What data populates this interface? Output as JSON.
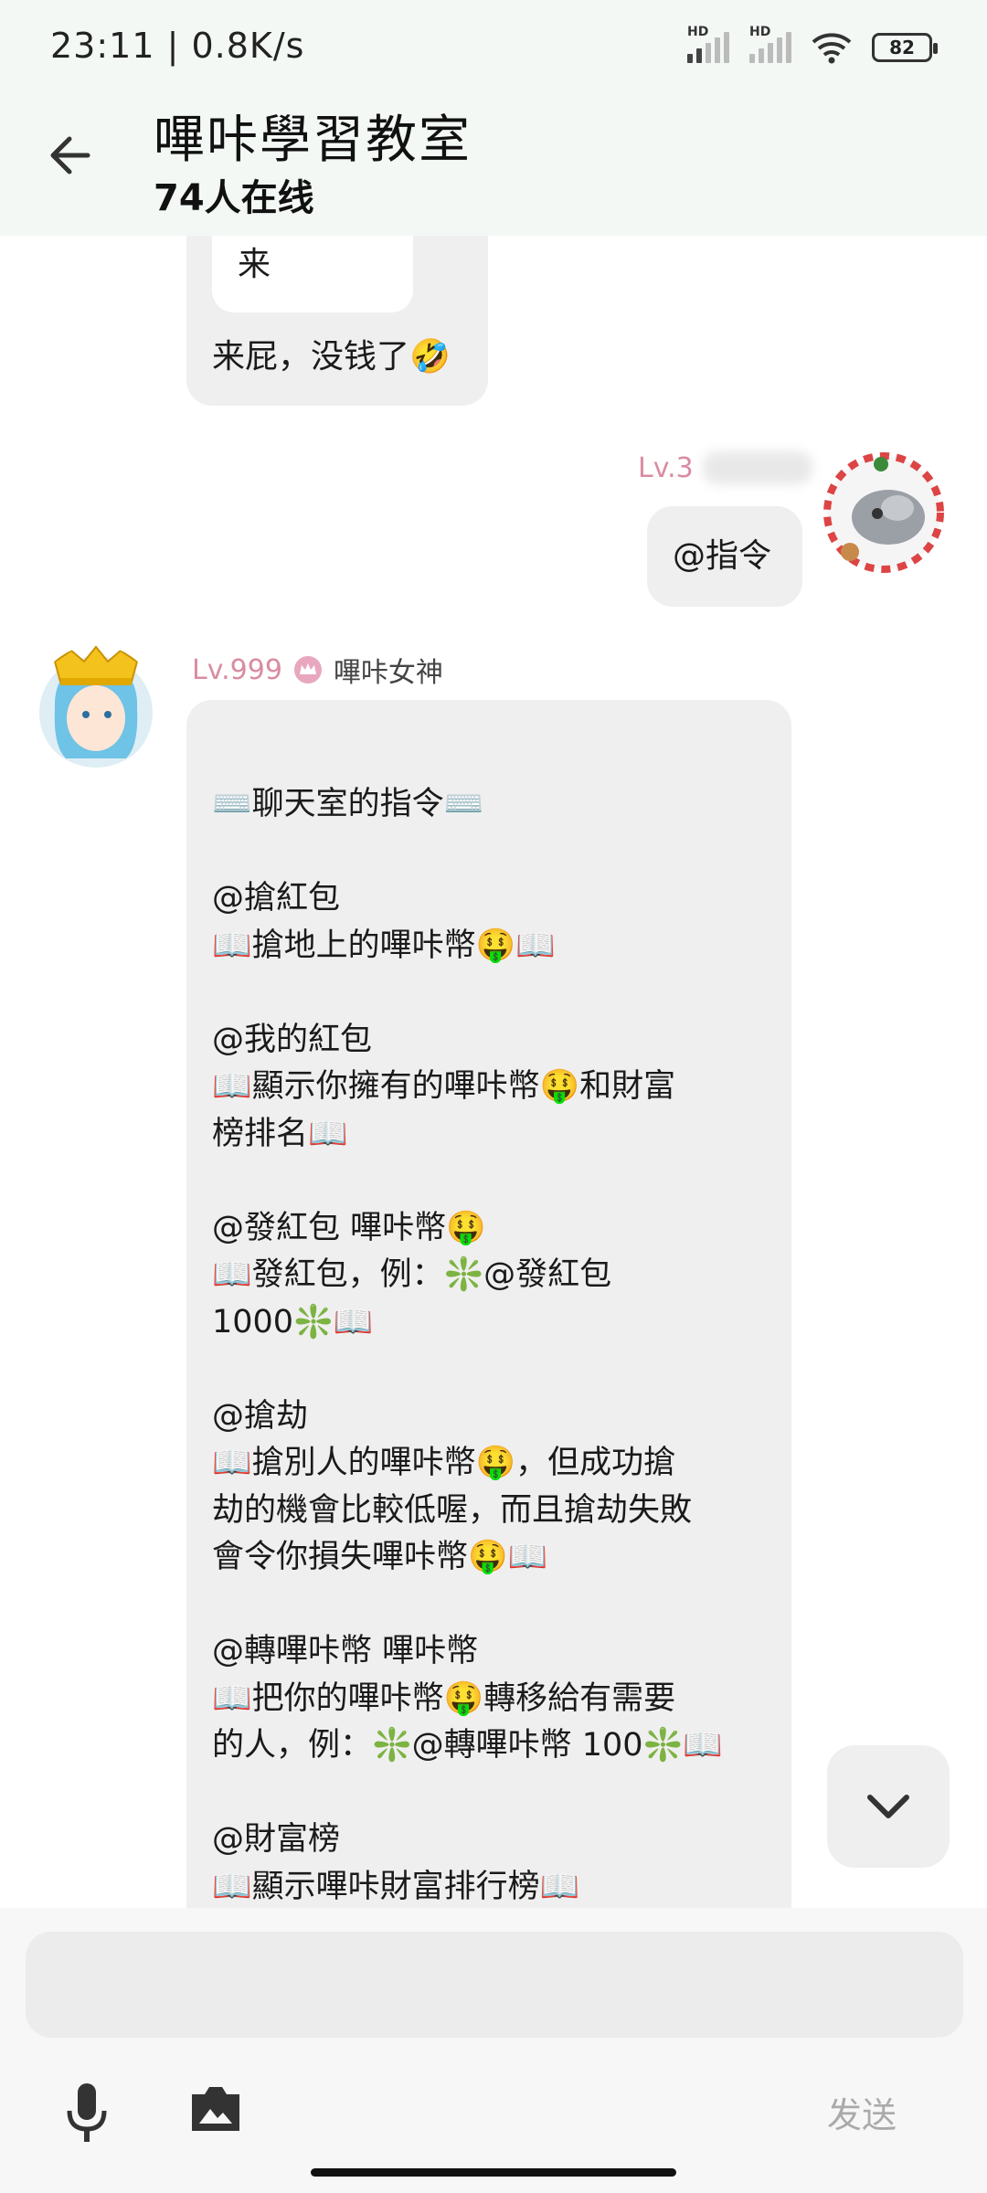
{
  "status": {
    "time": "23:11 | 0.8K/s",
    "signal1_label": "HD",
    "signal2_label": "HD",
    "battery": "82"
  },
  "header": {
    "title": "嗶咔學習教室",
    "online": "74人在线",
    "back_icon": "arrow-left-icon"
  },
  "messages": {
    "quoted_text": "来",
    "reply_text": "来屁，没钱了🤣",
    "my_level": "Lv.3",
    "my_message": "@指令",
    "bot_level": "Lv.999",
    "bot_name": "嗶咔女神",
    "command_lines": [
      "⌨️聊天室的指令⌨️",
      "",
      "@搶紅包",
      "📖搶地上的嗶咔幣🤑📖",
      "",
      "@我的紅包",
      "📖顯示你擁有的嗶咔幣🤑和財富",
      "榜排名📖",
      "",
      "@發紅包 嗶咔幣🤑",
      "📖發紅包，例：❇️@發紅包",
      "1000❇️📖",
      "",
      "@搶劫",
      "📖搶別人的嗶咔幣🤑，但成功搶",
      "劫的機會比較低喔，而且搶劫失敗",
      "會令你損失嗶咔幣🤑📖",
      "",
      "@轉嗶咔幣 嗶咔幣",
      "📖把你的嗶咔幣🤑轉移給有需要",
      "的人，例：❇️@轉嗶咔幣 100❇️📖",
      "",
      "@財富榜",
      "📖顯示嗶咔財富排行榜📖"
    ]
  },
  "input": {
    "placeholder": "",
    "send_label": "发送"
  }
}
